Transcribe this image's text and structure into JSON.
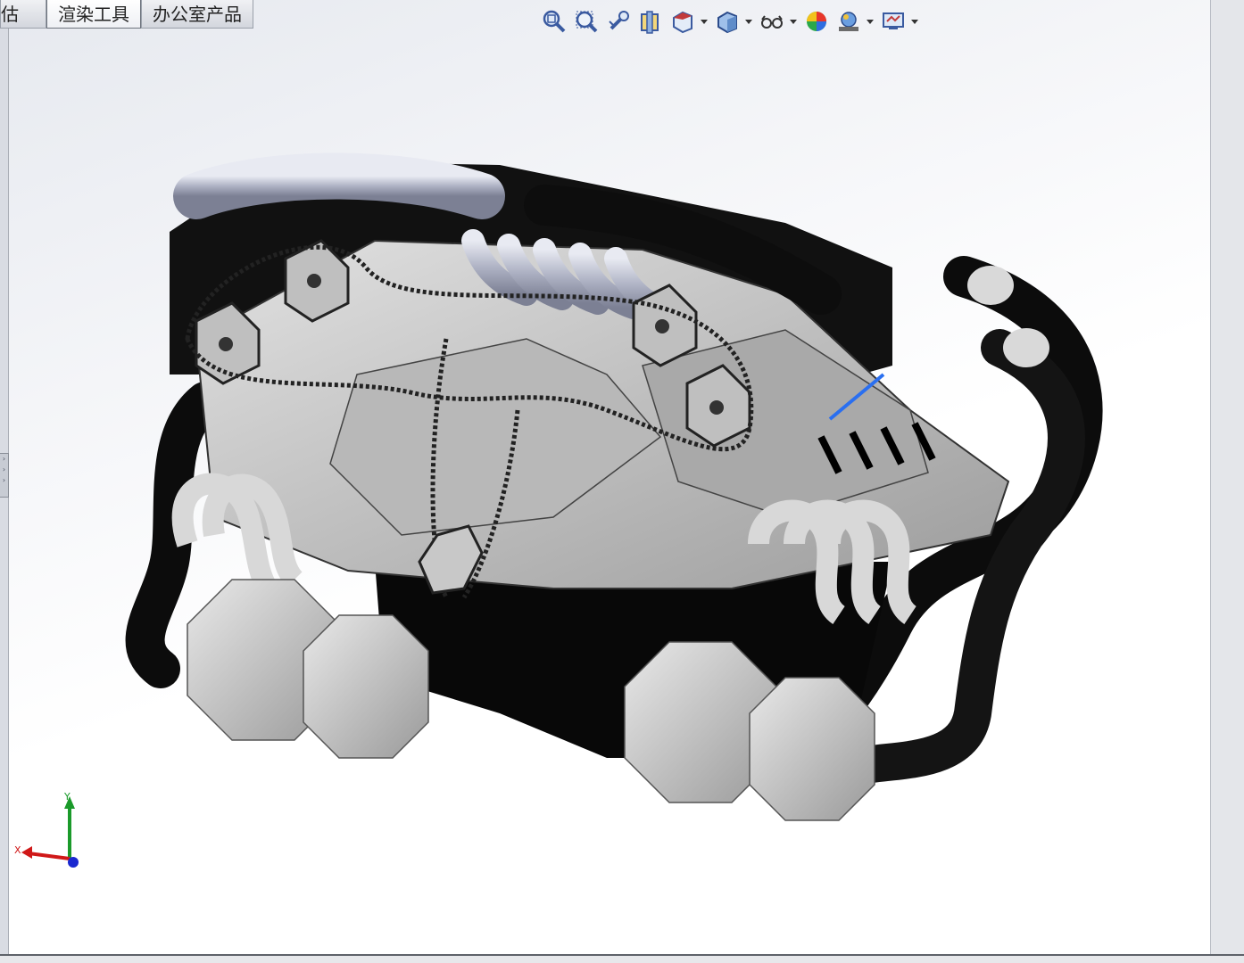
{
  "tabs": [
    {
      "label": "估",
      "active": false
    },
    {
      "label": "渲染工具",
      "active": true
    },
    {
      "label": "办公室产品",
      "active": false
    }
  ],
  "view_toolbar": {
    "icons": [
      "zoom-to-fit-icon",
      "zoom-to-area-icon",
      "previous-view-icon",
      "section-view-icon",
      "view-orientation-icon",
      "display-style-icon",
      "hide-show-items-icon",
      "edit-appearance-icon",
      "apply-scene-icon",
      "view-settings-icon"
    ]
  },
  "triad": {
    "x_label": "X",
    "y_label": "Y"
  },
  "colors": {
    "viewport_top": "#e6e9ef",
    "viewport_bottom": "#ffffff",
    "part_dark": "#111111",
    "part_light": "#c8c8c8",
    "part_silver": "#d9dbe0",
    "axis_x": "#d01818",
    "axis_y": "#1a9a2a",
    "axis_z": "#1a28d0"
  }
}
